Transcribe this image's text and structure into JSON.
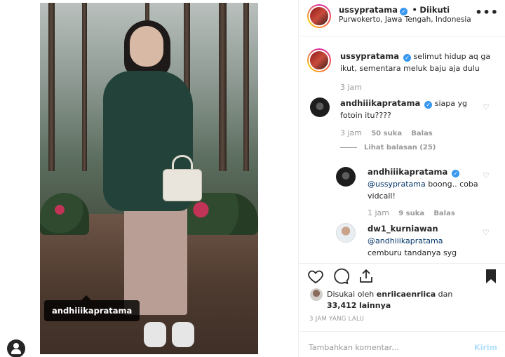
{
  "photo": {
    "tag_username": "andhiiikapratama"
  },
  "post_header": {
    "username": "ussypratama",
    "separator": "•",
    "follow_status": "Diikuti",
    "location": "Purwokerto, Jawa Tengah, Indonesia",
    "more_icon": "more-horizontal-icon"
  },
  "caption": {
    "username": "ussypratama",
    "text": "selimut hidup aq ga ikut, sementara meluk baju aja dulu",
    "time": "3 jam"
  },
  "comments": [
    {
      "username": "andhiiikapratama",
      "text": "siapa yg fotoin itu????",
      "time": "3 jam",
      "likes": "50 suka",
      "reply_label": "Balas",
      "view_replies": "Lihat balasan (25)"
    }
  ],
  "replies": [
    {
      "username": "andhiiikapratama",
      "mention": "@ussypratama",
      "text": "boong.. coba vidcall!",
      "time": "1 jam",
      "likes": "9 suka",
      "reply_label": "Balas"
    },
    {
      "username": "dw1_kurniawan",
      "mention": "@andhiiikapratama",
      "text": "cemburu tandanya syg"
    }
  ],
  "likes_line": {
    "prefix": "Disukai oleh",
    "first_user": "enriicaenriica",
    "conjunction": "dan",
    "count": "33,412",
    "suffix": "lainnya"
  },
  "post_time": "3 JAM YANG LALU",
  "add_comment": {
    "placeholder": "Tambahkan komentar...",
    "send_label": "Kirim"
  },
  "colors": {
    "verified": "#3897f0",
    "link": "#003569",
    "muted": "#999999",
    "send_disabled": "#b2dffc"
  }
}
